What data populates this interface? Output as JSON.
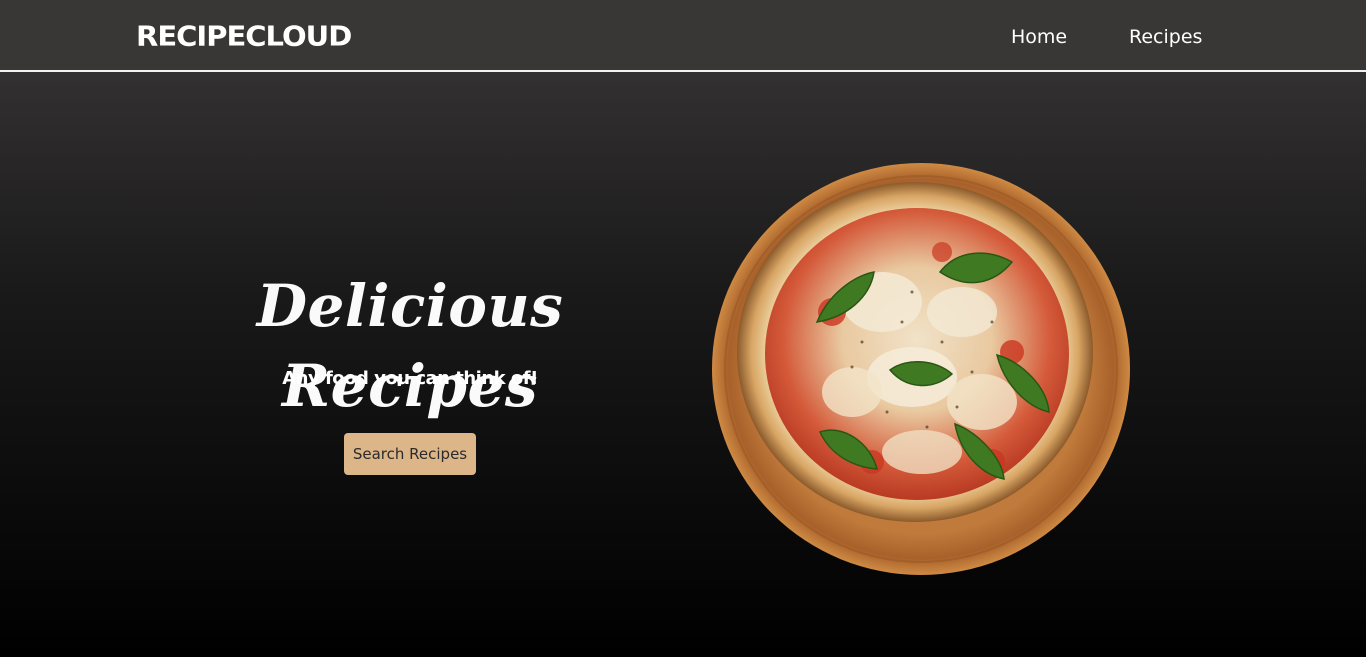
{
  "brand": {
    "logo_text": "RecipeCloud"
  },
  "nav": {
    "items": [
      {
        "label": "Home"
      },
      {
        "label": "Recipes"
      }
    ]
  },
  "hero": {
    "title": "Delicious Recipes",
    "subtitle": "Any food you can think of!",
    "cta_label": "Search Recipes",
    "cta_color": "#dcb588"
  },
  "image": {
    "subject": "pizza-image"
  }
}
